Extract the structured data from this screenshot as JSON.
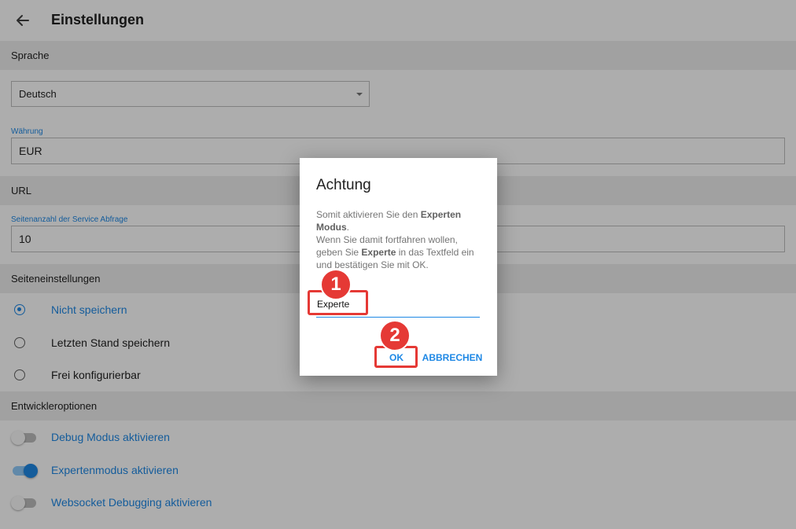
{
  "appbar": {
    "title": "Einstellungen"
  },
  "language": {
    "header": "Sprache",
    "selected": "Deutsch"
  },
  "currency": {
    "label": "Währung",
    "value": "EUR"
  },
  "url": {
    "header": "URL",
    "page_count_label": "Seitenanzahl der Service Abfrage",
    "page_count_value": "10"
  },
  "page_settings": {
    "header": "Seiteneinstellungen",
    "options": [
      {
        "label": "Nicht speichern",
        "checked": true
      },
      {
        "label": "Letzten Stand speichern",
        "checked": false
      },
      {
        "label": "Frei konfigurierbar",
        "checked": false
      }
    ]
  },
  "developer": {
    "header": "Entwickleroptionen",
    "toggles": [
      {
        "label": "Debug Modus aktivieren",
        "on": false
      },
      {
        "label": "Expertenmodus aktivieren",
        "on": true
      },
      {
        "label": "Websocket Debugging aktivieren",
        "on": false
      }
    ]
  },
  "dialog": {
    "title": "Achtung",
    "message_part1": "Somit aktivieren Sie den ",
    "message_bold1": "Experten Modus",
    "message_part2": ".",
    "message_part3": "Wenn Sie damit fortfahren wollen, geben Sie ",
    "message_bold2": "Experte",
    "message_part4": " in das Textfeld ein und bestätigen Sie mit OK.",
    "input_value": "Experte",
    "ok_label": "OK",
    "cancel_label": "ABBRECHEN"
  },
  "annotations": {
    "step1": "1",
    "step2": "2",
    "color": "#e53935"
  },
  "colors": {
    "accent": "#1e88e5",
    "section_bg": "#eeeeee"
  }
}
